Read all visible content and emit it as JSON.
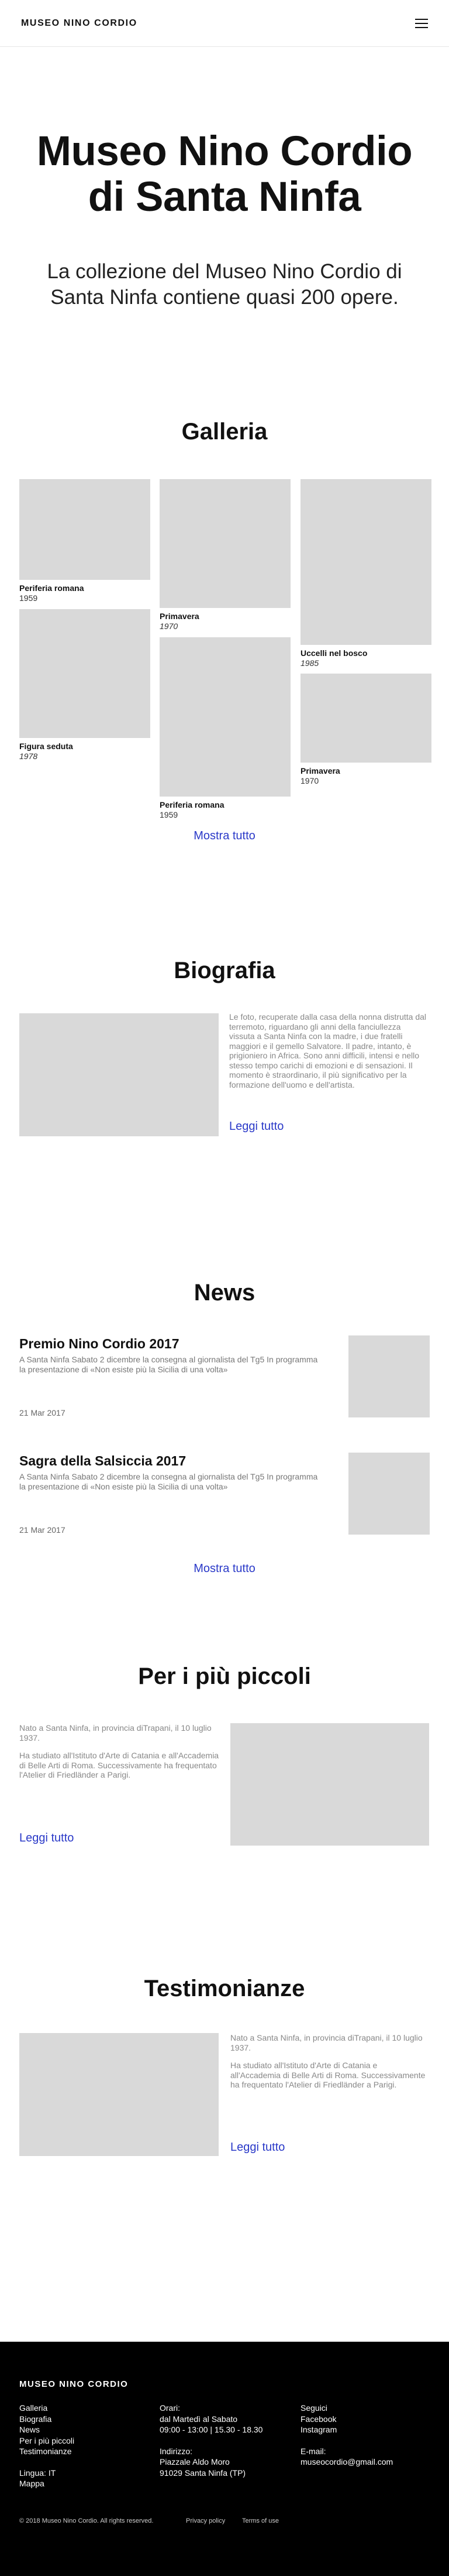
{
  "header": {
    "brand": "MUSEO NINO CORDIO"
  },
  "hero": {
    "title_line1": "Museo Nino Cordio",
    "title_line2": "di Santa Ninfa",
    "subtitle": "La collezione del Museo Nino Cordio di Santa Ninfa contiene quasi 200 opere."
  },
  "gallery": {
    "title": "Galleria",
    "items": [
      {
        "name": "Periferia romana",
        "year": "1959"
      },
      {
        "name": "Figura seduta",
        "year": "1978"
      },
      {
        "name": "Primavera",
        "year": "1970"
      },
      {
        "name": "Periferia romana",
        "year": "1959"
      },
      {
        "name": "Uccelli nel bosco",
        "year": "1985"
      },
      {
        "name": "Primavera",
        "year": "1970"
      }
    ],
    "show_all": "Mostra tutto"
  },
  "bio": {
    "title": "Biografia",
    "text": "Le foto, recuperate dalla casa della nonna distrutta dal terremoto, riguardano gli anni della fanciullezza vissuta a Santa Ninfa con la madre, i due fratelli maggiori e il gemello Salvatore. Il padre, intanto, è prigioniero in Africa. Sono anni difficili, intensi e nello stesso tempo carichi di emozioni e di sensazioni. Il momento è straordinario, il più significativo per la formazione dell'uomo e dell'artista.",
    "link": "Leggi tutto"
  },
  "news": {
    "title": "News",
    "items": [
      {
        "title": "Premio Nino Cordio 2017",
        "text": "A Santa Ninfa Sabato 2 dicembre la consegna al giornalista del Tg5 In programma la presentazione di «Non esiste più la Sicilia di una volta»",
        "date": "21 Mar 2017"
      },
      {
        "title": "Sagra della Salsiccia 2017",
        "text": "A Santa Ninfa Sabato 2 dicembre la consegna al giornalista del Tg5 In programma la presentazione di «Non esiste più la Sicilia di una volta»",
        "date": "21 Mar 2017"
      }
    ],
    "show_all": "Mostra tutto"
  },
  "kids": {
    "title": "Per i più piccoli",
    "p1": "Nato a Santa Ninfa, in provincia diTrapani, il 10 luglio 1937.",
    "p2": "Ha studiato all'Istituto d'Arte di Catania e all'Accademia di Belle Arti di Roma. Successivamente ha frequentato l'Atelier di Friedländer a Parigi.",
    "link": "Leggi tutto"
  },
  "testimonials": {
    "title": "Testimonianze",
    "p1": "Nato a Santa Ninfa, in provincia diTrapani, il 10 luglio 1937.",
    "p2": "Ha studiato all'Istituto d'Arte di Catania e all'Accademia di Belle Arti di Roma. Successivamente ha frequentato l'Atelier di Friedländer a Parigi.",
    "link": "Leggi tutto"
  },
  "footer": {
    "brand": "MUSEO NINO CORDIO",
    "nav": [
      "Galleria",
      "Biografia",
      "News",
      "Per i più piccoli",
      "Testimonianze"
    ],
    "lang": "Lingua: IT",
    "map": "Mappa",
    "hours_label": "Orari:",
    "hours_days": "dal Martedì al Sabato",
    "hours_time": "09:00 - 13:00 | 15.30 - 18.30",
    "address_label": "Indirizzo:",
    "address_street": "Piazzale Aldo Moro",
    "address_city": "91029 Santa Ninfa (TP)",
    "follow_label": "Seguici",
    "facebook": "Facebook",
    "instagram": "Instagram",
    "email_label": "E-mail:",
    "email": "museocordio@gmail.com",
    "copyright": "© 2018 Museo Nino Cordio. All rights reserved.",
    "privacy": "Privacy policy",
    "terms": "Terms of use"
  }
}
